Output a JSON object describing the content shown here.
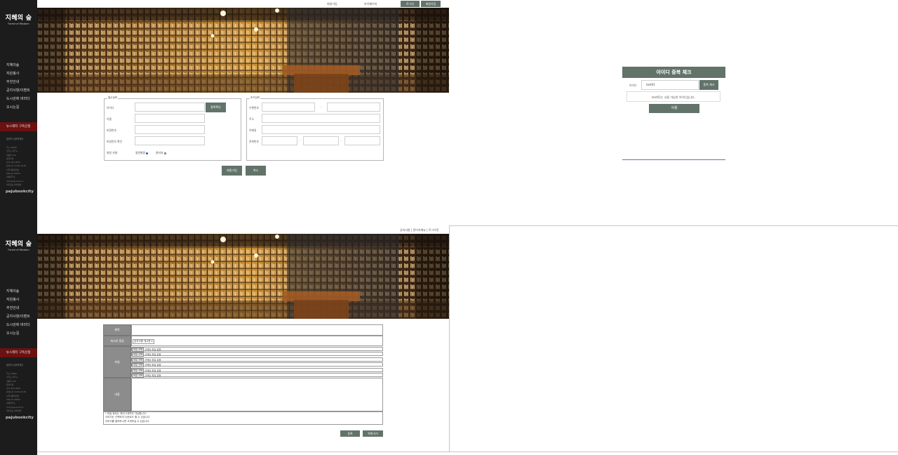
{
  "brand": {
    "logo_main": "지혜의 숲",
    "logo_sub": "Forest of Wisdom",
    "footer_brand": "pajubookcity"
  },
  "sidebar": {
    "menu": [
      "지혜의숲",
      "자원봉사",
      "추천안내",
      "공지사항/이벤트",
      "도시관에 바라다",
      "오시는길"
    ],
    "newsletter": "뉴스레터 구독신청",
    "partners": "출판도시문화재단",
    "info_lines": [
      "주소 00000",
      "경기도 파주시",
      "회동길 145",
      "문의전화",
      "031-955-0000",
      "운영시간 10:00-20:00",
      "사업자등록번호",
      "000-00-00000",
      "이메일주소",
      "info@pajubook.kr",
      "개인정보 처리방침"
    ]
  },
  "topbar": {
    "link1": "회원가입",
    "link2": "마이페이지",
    "login_label": "로그인",
    "logout_label": "회원가입"
  },
  "topbar_bottom": {
    "links": "공지사항 | 관리자메뉴 | 로그아웃"
  },
  "signup": {
    "legend_left": "필수입력",
    "legend_right": "추가입력",
    "id_label": "아이디",
    "dup_button": "중복확인",
    "name_label": "이름",
    "pw_label": "비밀번호",
    "pw_confirm_label": "비밀번호 확인",
    "type_label": "회원 유형",
    "type_opt1": "일반회원",
    "type_opt2": "관리자",
    "zip_label": "우편번호",
    "addr_label": "주소",
    "email_label": "이메일",
    "phone_label": "전화번호",
    "sep": "-",
    "submit_label": "회원가입",
    "cancel_label": "취소"
  },
  "popup": {
    "title": "아이디 중복 체크",
    "id_label": "아이디",
    "id_value": "test01",
    "check_label": "중복 체크",
    "message": "test01는 사용 가능한 아이디입니다.",
    "use_label": "사용"
  },
  "board": {
    "title_label": "제목",
    "category_label": "게시판 종류",
    "category_value": "공지사항 게시판",
    "files_label": "파일",
    "content_label": "내용",
    "file_button": "파일 선택",
    "file_none": "선택된 파일 없음",
    "notes": [
      "* 파일 첨부는 최대 5개까지 가능합니다.",
      "이미지는 선택하여 다운로드 할 수 있습니다.",
      "이미지를 클릭하시면 크게보실 수 있습니다."
    ],
    "submit_label": "등록",
    "list_label": "목록가기"
  }
}
